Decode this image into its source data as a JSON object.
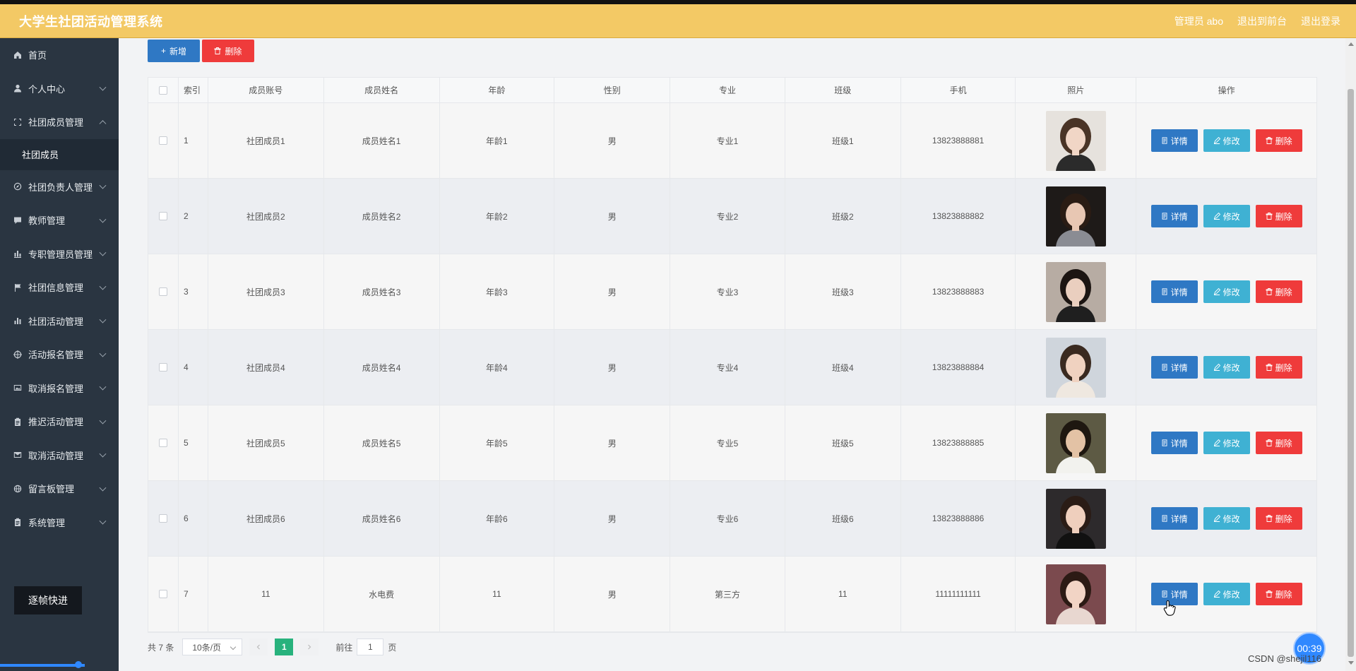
{
  "app": {
    "title": "大学生社团活动管理系统"
  },
  "header": {
    "admin": "管理员 abo",
    "to_front": "退出到前台",
    "logout": "退出登录"
  },
  "sidebar": {
    "items": [
      {
        "label": "首页",
        "icon": "home-icon",
        "expandable": false
      },
      {
        "label": "个人中心",
        "icon": "user-icon",
        "expandable": true
      },
      {
        "label": "社团成员管理",
        "icon": "fullscreen-icon",
        "expandable": true,
        "expanded": true,
        "children": [
          "社团成员"
        ]
      },
      {
        "label": "社团负责人管理",
        "icon": "compass-icon",
        "expandable": true
      },
      {
        "label": "教师管理",
        "icon": "chat-icon",
        "expandable": true
      },
      {
        "label": "专职管理员管理",
        "icon": "chart-icon",
        "expandable": true
      },
      {
        "label": "社团信息管理",
        "icon": "flag-icon",
        "expandable": true
      },
      {
        "label": "社团活动管理",
        "icon": "bar-chart-icon",
        "expandable": true
      },
      {
        "label": "活动报名管理",
        "icon": "target-icon",
        "expandable": true
      },
      {
        "label": "取消报名管理",
        "icon": "picture-icon",
        "expandable": true
      },
      {
        "label": "推迟活动管理",
        "icon": "clipboard-icon",
        "expandable": true
      },
      {
        "label": "取消活动管理",
        "icon": "mail-icon",
        "expandable": true
      },
      {
        "label": "留言板管理",
        "icon": "globe-icon",
        "expandable": true
      },
      {
        "label": "系统管理",
        "icon": "clipboard-icon",
        "expandable": true
      }
    ],
    "speed_button": "逐帧快进"
  },
  "toolbar": {
    "add_label": "新增",
    "delete_label": "删除"
  },
  "table": {
    "headers": [
      "索引",
      "成员账号",
      "成员姓名",
      "年龄",
      "性别",
      "专业",
      "班级",
      "手机",
      "照片",
      "操作"
    ],
    "rows": [
      {
        "index": "1",
        "account": "社团成员1",
        "name": "成员姓名1",
        "age": "年龄1",
        "gender": "男",
        "major": "专业1",
        "class": "班级1",
        "phone": "13823888881"
      },
      {
        "index": "2",
        "account": "社团成员2",
        "name": "成员姓名2",
        "age": "年龄2",
        "gender": "男",
        "major": "专业2",
        "class": "班级2",
        "phone": "13823888882"
      },
      {
        "index": "3",
        "account": "社团成员3",
        "name": "成员姓名3",
        "age": "年龄3",
        "gender": "男",
        "major": "专业3",
        "class": "班级3",
        "phone": "13823888883"
      },
      {
        "index": "4",
        "account": "社团成员4",
        "name": "成员姓名4",
        "age": "年龄4",
        "gender": "男",
        "major": "专业4",
        "class": "班级4",
        "phone": "13823888884"
      },
      {
        "index": "5",
        "account": "社团成员5",
        "name": "成员姓名5",
        "age": "年龄5",
        "gender": "男",
        "major": "专业5",
        "class": "班级5",
        "phone": "13823888885"
      },
      {
        "index": "6",
        "account": "社团成员6",
        "name": "成员姓名6",
        "age": "年龄6",
        "gender": "男",
        "major": "专业6",
        "class": "班级6",
        "phone": "13823888886"
      },
      {
        "index": "7",
        "account": "11",
        "name": "水电费",
        "age": "11",
        "gender": "男",
        "major": "第三方",
        "class": "11",
        "phone": "11111111111"
      }
    ],
    "actions": {
      "detail": "详情",
      "edit": "修改",
      "remove": "删除"
    }
  },
  "pager": {
    "total": "共 7 条",
    "page_size": "10条/页",
    "current_page": "1",
    "goto_label": "前往",
    "goto_value": "1",
    "page_unit": "页"
  },
  "overlay": {
    "timer": "00:39",
    "watermark": "CSDN @shejil116"
  },
  "colors": {
    "header": "#f3c965",
    "sidebar": "#2a3541",
    "primary": "#2f78c4",
    "info": "#3fb1d3",
    "danger": "#ef3b3b",
    "page_active": "#28b27d"
  }
}
